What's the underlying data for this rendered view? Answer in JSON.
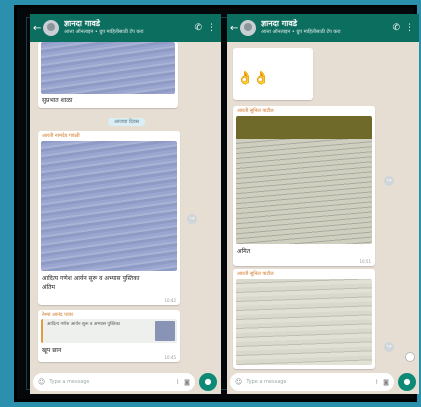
{
  "left_chat": {
    "name": "ज्ञानदा गावडे",
    "subtitle": "आत्ता ऑनलाइन • ग्रुप माहितीसाठी टॅप करा",
    "top_caption": "सुप्रभात शाळा",
    "date_chip": "आजचा दिवस",
    "sender_1": "आरती नामदेव गवळी",
    "image_caption": "आदित्य गणेश आर्यन सुरू व अभ्यास पुस्तिका",
    "image_caption_2": "अंतिम",
    "time_1": "10:42",
    "reply_sender": "रेश्मा आनंद पवार",
    "reply_quote": "आदित्य गणेश आर्यन सुरू व अभ्यास पुस्तिका",
    "reply_text": "खूप छान",
    "time_2": "10:45",
    "input_placeholder": "Type a message"
  },
  "right_chat": {
    "name": "ज्ञानदा गावडे",
    "subtitle": "आत्ता ऑनलाइन • ग्रुप माहितीसाठी टॅप करा",
    "emoji_msg": "👌👌",
    "sender_1": "आरती सुनिल पाटील",
    "caption_1": "अमित",
    "time_1": "10:51",
    "sender_2": "आरती सुनिल पाटील",
    "input_placeholder": "Type a message"
  },
  "colors": {
    "header": "#0c6e5e",
    "chat_bg": "#e6ddd3",
    "page_bg": "#2b8fae",
    "send": "#0c8a76"
  }
}
